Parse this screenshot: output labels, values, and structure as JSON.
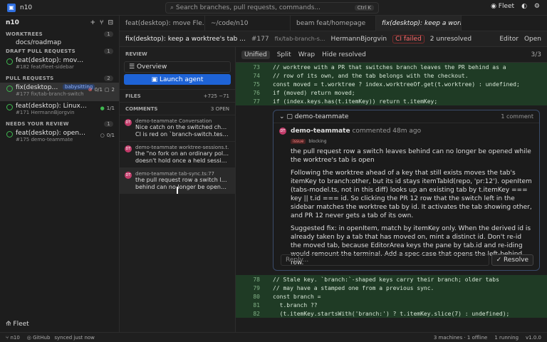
{
  "top": {
    "workspace": "n10",
    "search_placeholder": "Search branches, pull requests, commands...",
    "kbd": "Ctrl K",
    "right": [
      "Fleet"
    ]
  },
  "sidebar": {
    "title": "n10",
    "sections": [
      {
        "name": "WORKTREES",
        "count": "1",
        "items": [
          "docs/roadmap"
        ]
      },
      {
        "name": "DRAFT PULL REQUESTS",
        "count": "1",
        "items": [
          {
            "t": "feat(desktop): move Fleet into the...",
            "m": "#182 feat/fleet-sidebar"
          }
        ]
      },
      {
        "name": "PULL REQUESTS",
        "count": "2",
        "items": [
          {
            "t": "fix(desktop): k...",
            "m": "#177 fix/tab-branch-switch",
            "tag": "babysitting",
            "s": "0/1",
            "c": "2"
          },
          {
            "t": "feat(desktop): Linux .deb and ...",
            "m": "#171 HermannBjorgvin",
            "s": "1/1"
          }
        ]
      },
      {
        "name": "NEEDS YOUR REVIEW",
        "count": "1",
        "items": [
          {
            "t": "feat(desktop): open the com...",
            "m": "#175 demo-teammate",
            "s": "0/1"
          }
        ]
      }
    ],
    "footer": "Fleet"
  },
  "tabs": [
    "feat(desktop): move Fle...",
    "~/code/n10",
    "beam  feat/homepage",
    "fix(desktop): keep a worktree..."
  ],
  "prhead": {
    "title": "fix(desktop): keep a worktree's tab ...",
    "num": "#177",
    "branch": "fix/tab-branch-s...",
    "author": "HermannBjorgvin",
    "ci": "CI failed",
    "unresolved": "2 unresolved",
    "editor": "Editor",
    "open": "Open"
  },
  "review": {
    "title": "REVIEW",
    "overview": "Overview",
    "launch": "Launch agent",
    "files": "FILES",
    "files_stat": "+725 −71",
    "comments": "COMMENTS",
    "comments_badge": "3 OPEN",
    "items": [
      {
        "h": "demo-teammate  Conversation",
        "b1": "Nice catch on the switched checkout.",
        "b2": "CI is red on `branch-switch.test.ts`..."
      },
      {
        "h": "demo-teammate  worktree-sessions.t...",
        "b1": "the \"no fork on an ordinary poll\" claim",
        "b2": "doesn't hold once a held session..."
      },
      {
        "h": "demo-teammate  tab-sync.ts:77",
        "b1": "the pull request row a switch leaves",
        "b2": "behind can no longer be opened whil..."
      }
    ]
  },
  "toolbar": {
    "unified": "Unified",
    "split": "Split",
    "wrap": "Wrap",
    "hide": "Hide resolved",
    "page": "3/3"
  },
  "code_top": [
    [
      "73",
      "// worktree with a PR that switches branch leaves the PR behind as a"
    ],
    [
      "74",
      "// row of its own, and the tab belongs with the checkout."
    ],
    [
      "75",
      "const moved = t.worktree ? index.worktreeOf.get(t.worktree) : undefined;"
    ],
    [
      "76",
      "if (moved) return moved;"
    ],
    [
      "77",
      "if (index.keys.has(t.itemKey)) return t.itemKey;"
    ]
  ],
  "thread": {
    "head": "demo-teammate",
    "count": "1 comment",
    "author": "demo-teammate",
    "time": "commented 48m ago",
    "tag": "issue",
    "tag2": "blocking",
    "p1": "the pull request row a switch leaves behind can no longer be opened while the worktree's tab is open",
    "p2": "Following the worktree ahead of a key that still exists moves the tab's itemKey to branch:other, but its id stays itemTabId(repo, 'pr:12'). openItem (tabs-model.ts, not in this diff) looks up an existing tab by t.itemKey === key || t.id === id. So clicking the PR 12 row that the switch left in the sidebar matches the worktree tab by id. It activates the tab showing other, and PR 12 never gets a tab of its own.",
    "p3": "Suggested fix: in openItem, match by itemKey only. When the derived id is already taken by a tab that has moved on, mint a distinct id. Don't re-id the moved tab, because EditorArea keys the pane by tab.id and re-iding would remount the terminal. Add a spec case that opens the left-behind row.",
    "reply": "Reply...",
    "resolve": "Resolve"
  },
  "code_bottom": [
    [
      "78",
      "// Stale key. `branch:`-shaped keys carry their branch; older tabs"
    ],
    [
      "79",
      "// may have a stamped one from a previous sync."
    ],
    [
      "80",
      "const branch ="
    ],
    [
      "81",
      "  t.branch ??"
    ],
    [
      "82",
      "  (t.itemKey.startsWith('branch:') ? t.itemKey.slice(7) : undefined);"
    ]
  ],
  "status": {
    "left": "n10",
    "gh": "GitHub",
    "sync": "synced just now",
    "machines": "3 machines · 1 offline",
    "running": "1 running",
    "ver": "v1.0.0"
  }
}
